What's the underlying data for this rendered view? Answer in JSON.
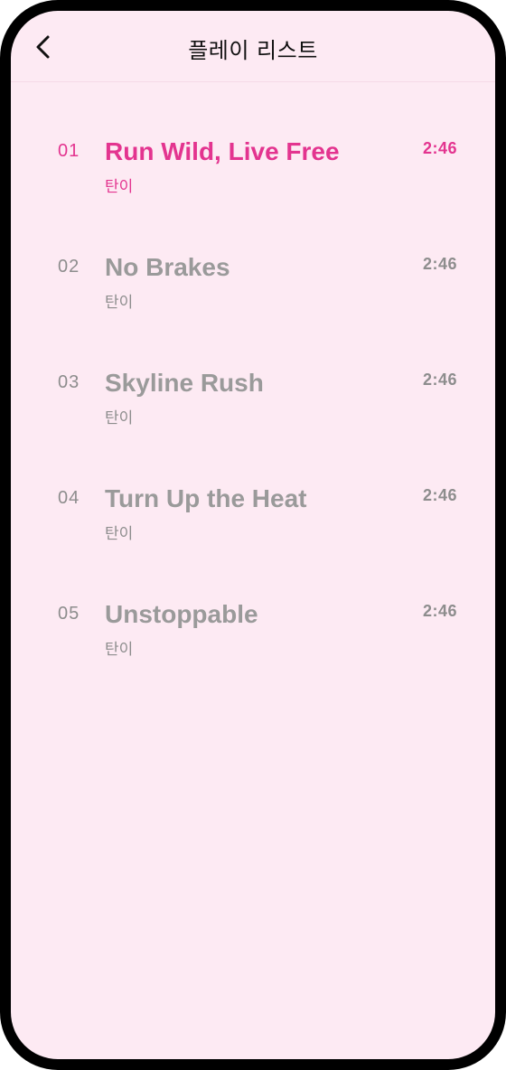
{
  "header": {
    "title": "플레이 리스트",
    "back_icon": "chevron-left-icon"
  },
  "colors": {
    "accent": "#e3348f",
    "background": "#fdeaf3",
    "inactive": "#9a9a9a"
  },
  "tracks": [
    {
      "num": "01",
      "title": "Run Wild, Live Free",
      "artist": "탄이",
      "duration": "2:46",
      "active": true
    },
    {
      "num": "02",
      "title": "No Brakes",
      "artist": "탄이",
      "duration": "2:46",
      "active": false
    },
    {
      "num": "03",
      "title": "Skyline Rush",
      "artist": "탄이",
      "duration": "2:46",
      "active": false
    },
    {
      "num": "04",
      "title": "Turn Up the Heat",
      "artist": "탄이",
      "duration": "2:46",
      "active": false
    },
    {
      "num": "05",
      "title": "Unstoppable",
      "artist": "탄이",
      "duration": "2:46",
      "active": false
    }
  ]
}
